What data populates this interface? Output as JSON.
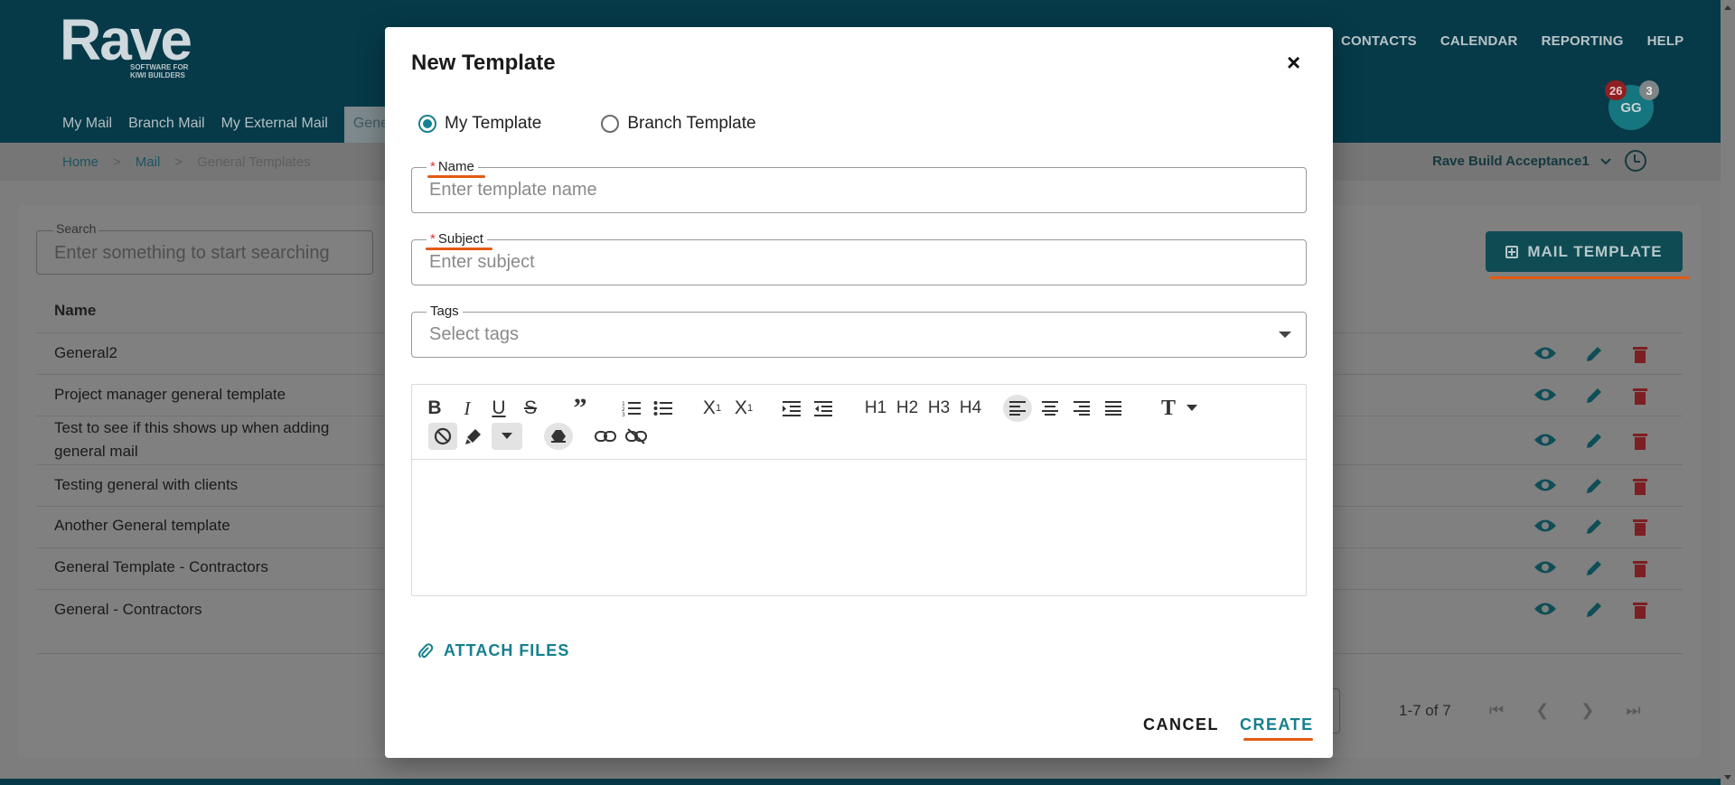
{
  "header": {
    "logo_word": "Rave",
    "logo_tagline": "SOFTWARE FOR\nKIWI BUILDERS",
    "top_nav": [
      "CONTACTS",
      "CALENDAR",
      "REPORTING",
      "HELP"
    ],
    "avatar_initials": "GG",
    "badge_notifications": "26",
    "badge_messages": "3",
    "sub_nav": [
      "My Mail",
      "Branch Mail",
      "My External Mail",
      "Gener"
    ]
  },
  "breadcrumb": {
    "home": "Home",
    "mail": "Mail",
    "current": "General Templates",
    "sep": ">"
  },
  "company_selector": "Rave Build Acceptance1",
  "search": {
    "label": "Search",
    "placeholder": "Enter something to start searching"
  },
  "mail_template_button": "MAIL TEMPLATE",
  "table": {
    "column_name": "Name",
    "rows": [
      "General2",
      "Project manager general template",
      "Test to see if this shows up when adding general mail",
      "Testing general with clients",
      "Another General template",
      "General Template - Contractors",
      "General - Contractors"
    ]
  },
  "pagination": {
    "range": "1-7 of 7"
  },
  "modal": {
    "title": "New Template",
    "close": "×",
    "radio_my": "My Template",
    "radio_branch": "Branch Template",
    "selected": "My Template",
    "required_mark": "*",
    "name_label": "Name",
    "name_placeholder": "Enter template name",
    "subject_label": "Subject",
    "subject_placeholder": "Enter subject",
    "tags_label": "Tags",
    "tags_placeholder": "Select tags",
    "toolbar": {
      "h1": "H1",
      "h2": "H2",
      "h3": "H3",
      "h4": "H4"
    },
    "attach_files": "ATTACH FILES",
    "cancel": "CANCEL",
    "create": "CREATE"
  },
  "colors": {
    "brand_dark": "#063a49",
    "accent_teal": "#16808d",
    "required_red": "#d23b2e",
    "highlight_orange": "#e35a12"
  }
}
